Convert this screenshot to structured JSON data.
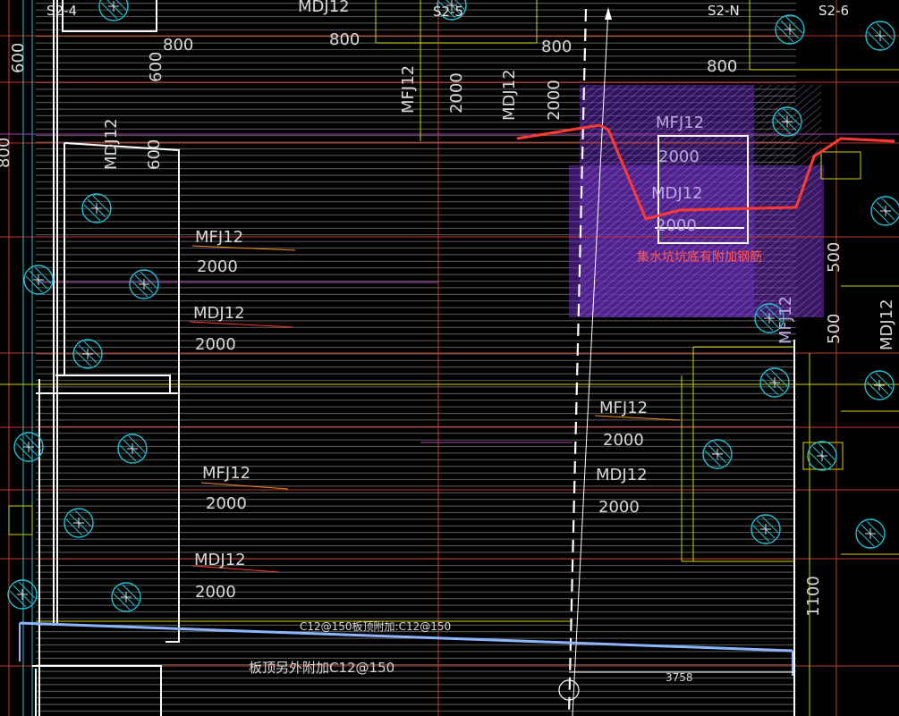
{
  "canvas": {
    "background": "#000000"
  },
  "colors": {
    "slab_hatch": "#8a8a8a",
    "grid_red": "#c0392b",
    "wall_white": "#ffffff",
    "cyan": "#20c4d8",
    "yellow": "#d4d400",
    "magenta": "#b040b0",
    "pit_purple": "#6a2bb8",
    "red_profile": "#ff3b30",
    "blue_beam": "#8fb4ff",
    "note_red": "#ff5a5a"
  },
  "grid_labels": [
    "S2-4",
    "S2-5",
    "S2-N",
    "S2-6"
  ],
  "labels": {
    "top_mdj": "MDJ12",
    "top_800_a": "800",
    "top_800_b": "800",
    "top_800_c": "800",
    "top_800_d": "800",
    "left_600": "600",
    "col_600": "600",
    "left_800": "800",
    "mfj_vert_a": "MFJ12",
    "v2000_a": "2000",
    "mdj_vert_a": "MDJ12",
    "v2000_b": "2000",
    "left_mdj_vert": "MDJ12",
    "left_600_vert": "600",
    "mfj_a": "MFJ12",
    "d2000_a": "2000",
    "mdj_a": "MDJ12",
    "d2000_b": "2000",
    "mfj_b": "MFJ12",
    "d2000_c": "2000",
    "mdj_b": "MDJ12",
    "d2000_d": "2000",
    "pit_mfj": "MFJ12",
    "pit_2000_a": "2000",
    "pit_mdj": "MDJ12",
    "pit_2000_b": "2000",
    "mid_mfj": "MFJ12",
    "mid_2000_a": "2000",
    "mid_mdj": "MDJ12",
    "mid_2000_b": "2000",
    "right_500_a": "500",
    "right_500_b": "500",
    "right_mfj_vert": "MFJ12",
    "right_mdj_vert": "MDJ12",
    "right_1100": "1100",
    "beam_note": "C12@150板顶附加:C12@150",
    "beam_note_b": "板顶另外附加C12@150",
    "dim_3758": "3758"
  },
  "pit_note": "集水坑坑底有附加钢筋",
  "pile_icon": "pile-cap-circle-icon"
}
